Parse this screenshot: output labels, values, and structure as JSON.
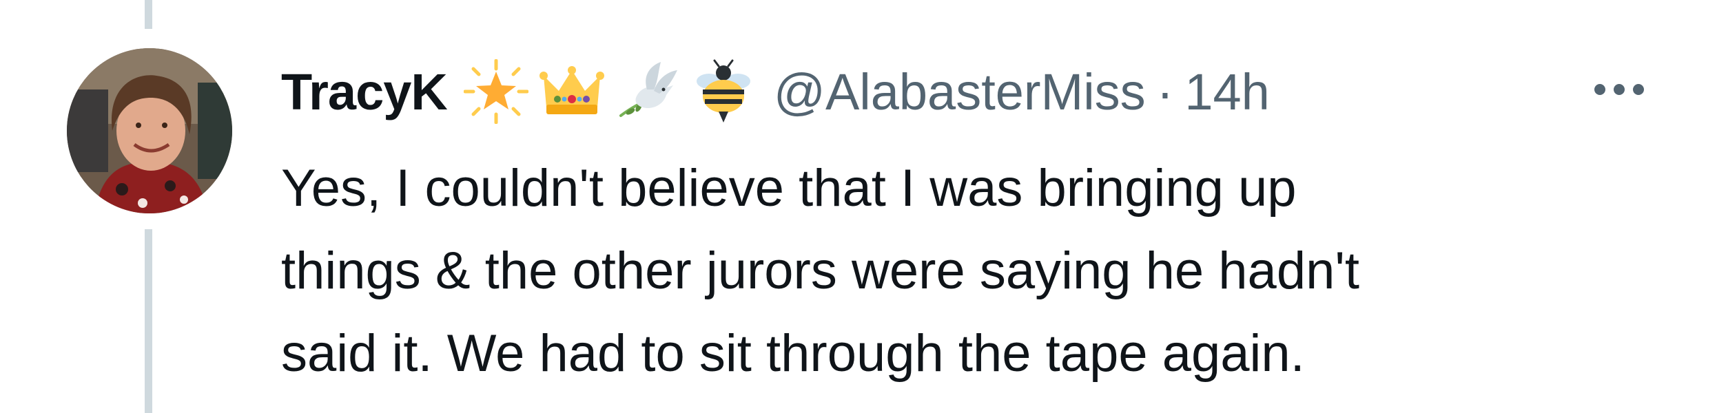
{
  "tweet": {
    "display_name": "TracyK",
    "badges": [
      "star-emoji-icon",
      "crown-emoji-icon",
      "dove-emoji-icon",
      "bee-emoji-icon"
    ],
    "handle": "@AlabasterMiss",
    "separator": "·",
    "timestamp": "14h",
    "text_lines": [
      "Yes, I couldn't believe that I was bringing up",
      "things & the other jurors were saying he hadn't",
      "said it. We had to sit through the tape again."
    ]
  },
  "icons": {
    "more": "more-options-icon",
    "avatar": "user-avatar"
  },
  "colors": {
    "primary_text": "#0f1419",
    "secondary_text": "#536471",
    "thread_line": "#cfd9de",
    "background": "#ffffff"
  }
}
